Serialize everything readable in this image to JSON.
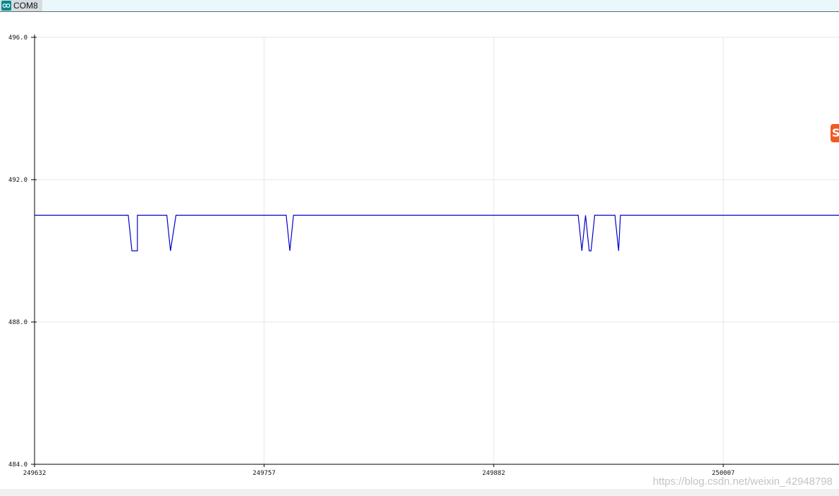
{
  "window": {
    "title": "COM8",
    "icon": "arduino-logo-icon"
  },
  "side_icon": {
    "icon": "csdn-logo-icon",
    "glyph": "S",
    "color": "#f05a22"
  },
  "watermark": "https://blog.csdn.net/weixin_42948798",
  "chart_data": {
    "type": "line",
    "title": "",
    "xlabel": "",
    "ylabel": "",
    "xlim": [
      249632,
      250070
    ],
    "ylim": [
      484.0,
      496.0
    ],
    "x_ticks": [
      249632,
      249757,
      249882,
      250007
    ],
    "x_tick_labels": [
      "249632",
      "249757",
      "249882",
      "250007"
    ],
    "y_ticks": [
      484.0,
      488.0,
      492.0,
      496.0
    ],
    "y_tick_labels": [
      "484.0",
      "488.0",
      "492.0",
      "496.0"
    ],
    "grid": true,
    "legend": "none",
    "series": [
      {
        "color": "#0000cc",
        "x": [
          249632,
          249683,
          249685,
          249688,
          249688,
          249704,
          249706,
          249709,
          249717,
          249769,
          249771,
          249773,
          249928,
          249930,
          249932,
          249934,
          249935,
          249937,
          249948,
          249950,
          249951,
          250070
        ],
        "values": [
          491.0,
          491.0,
          490.0,
          490.0,
          491.0,
          491.0,
          490.0,
          491.0,
          491.0,
          491.0,
          490.0,
          491.0,
          491.0,
          490.0,
          491.0,
          490.0,
          490.0,
          491.0,
          491.0,
          490.0,
          491.0,
          491.0
        ]
      }
    ]
  }
}
